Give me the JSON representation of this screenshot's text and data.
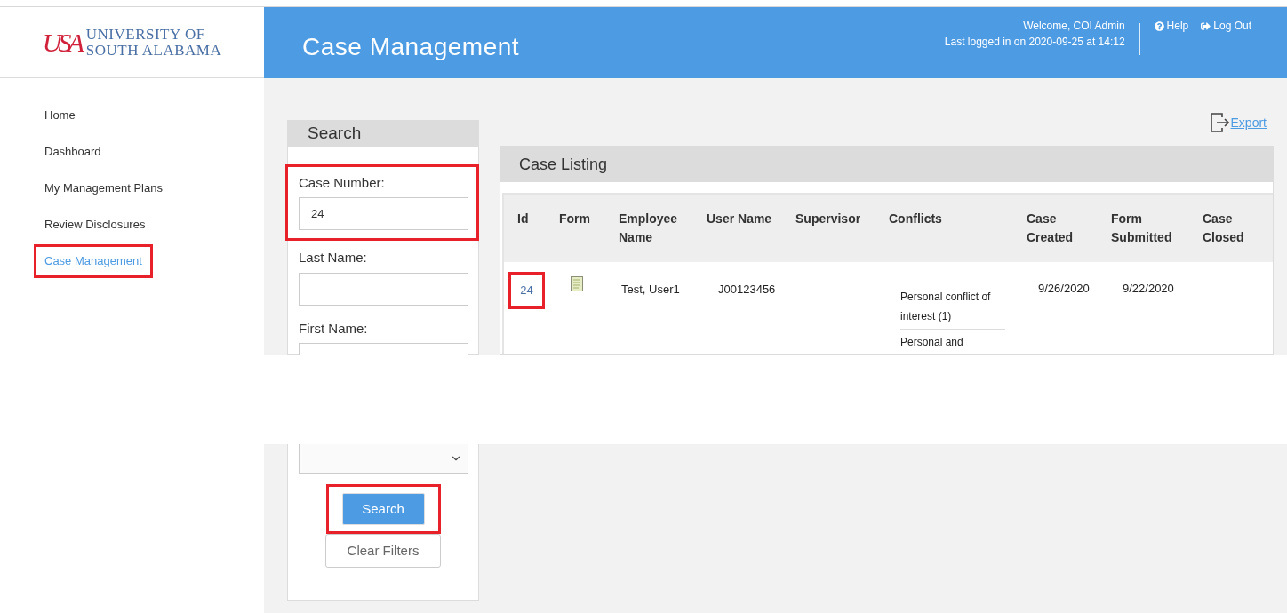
{
  "logo": {
    "mark": "USA",
    "line1": "UNIVERSITY OF",
    "line2": "SOUTH ALABAMA"
  },
  "header": {
    "title": "Case Management",
    "welcome": "Welcome, COI Admin",
    "last_login": "Last logged in on 2020-09-25 at 14:12",
    "links": [
      {
        "kind": "help",
        "label": "Help"
      },
      {
        "kind": "logout",
        "label": "Log Out"
      }
    ]
  },
  "sidebar": {
    "items": [
      {
        "label": "Home",
        "selected": false,
        "highlighted": false
      },
      {
        "label": "Dashboard",
        "selected": false,
        "highlighted": false
      },
      {
        "label": "My Management Plans",
        "selected": false,
        "highlighted": false
      },
      {
        "label": "Review Disclosures",
        "selected": false,
        "highlighted": false
      },
      {
        "label": "Case Management",
        "selected": true,
        "highlighted": true
      }
    ]
  },
  "search": {
    "title": "Search",
    "fields": [
      {
        "label": "Case Number:",
        "value": "24",
        "highlighted": true
      },
      {
        "label": "Last Name:",
        "highlighted": false
      },
      {
        "label": "First Name:",
        "highlighted": false
      }
    ],
    "select": {
      "kind": "select"
    },
    "buttons": [
      {
        "kind": "primary",
        "label": "Search",
        "highlighted": true
      },
      {
        "kind": "secondary",
        "label": "Clear Filters",
        "highlighted": false
      }
    ]
  },
  "case_listing": {
    "title": "Case Listing",
    "export": "Export",
    "columns": [
      "Id",
      "Form",
      "Employee Name",
      "User Name",
      "Supervisor",
      "Conflicts",
      "Case Created",
      "Form Submitted",
      "Case Closed"
    ],
    "rows": [
      {
        "id": "24",
        "id_highlighted": true,
        "employee_name": "Test, User1",
        "user_name": "J00123456",
        "conflicts": [
          "Personal conflict of interest (1)",
          "Personal and"
        ],
        "case_created": "9/26/2020",
        "form_submitted": "9/22/2020"
      }
    ]
  }
}
